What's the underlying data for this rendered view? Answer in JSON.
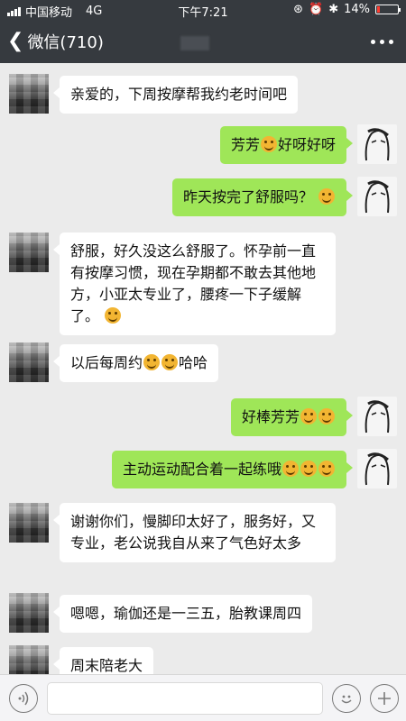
{
  "status_bar": {
    "carrier": "中国移动",
    "network": "4G",
    "time": "下午7:21",
    "battery": "14%",
    "battery_level": 0.14
  },
  "nav": {
    "back_label": "微信(710)"
  },
  "messages": [
    {
      "side": "left",
      "text": "亲爱的，下周按摩帮我约老时间吧"
    },
    {
      "side": "right",
      "text_a": "芳芳",
      "text_b": "好呀好呀"
    },
    {
      "side": "right",
      "text": "昨天按完了舒服吗？"
    },
    {
      "side": "left",
      "text": "舒服，好久没这么舒服了。怀孕前一直有按摩习惯，现在孕期都不敢去其他地方，小亚太专业了，腰疼一下子缓解了。"
    },
    {
      "side": "left",
      "text_a": "以后每周约",
      "text_b": "哈哈"
    },
    {
      "side": "right",
      "text": "好棒芳芳"
    },
    {
      "side": "right",
      "text": "主动运动配合着一起练哦"
    },
    {
      "side": "left",
      "text": "谢谢你们，慢脚印太好了，服务好，又专业，老公说我自从来了气色好太多"
    },
    {
      "side": "left",
      "text": "嗯嗯，瑜伽还是一三五，胎教课周四"
    },
    {
      "side": "left",
      "text": "周末陪老大"
    }
  ],
  "colors": {
    "topbar": "#363a3f",
    "chat_bg": "#ebebeb",
    "sent_bubble": "#9fe658",
    "received_bubble": "#ffffff"
  },
  "icons": [
    "back-chevron-icon",
    "more-dots-icon",
    "voice-icon",
    "emoji-icon",
    "plus-icon"
  ]
}
